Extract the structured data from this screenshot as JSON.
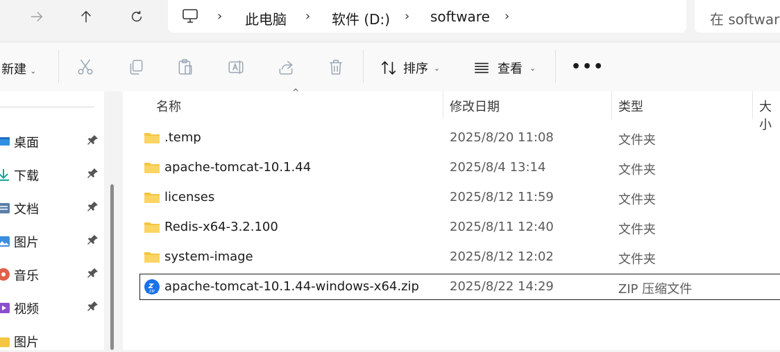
{
  "nav": {
    "forward_icon": "arrow-right-icon",
    "up_icon": "arrow-up-icon",
    "refresh_icon": "refresh-icon"
  },
  "address": {
    "computer_icon": "computer-icon",
    "crumbs": [
      "此电脑",
      "软件 (D:)",
      "software"
    ]
  },
  "search": {
    "placeholder": "在 software"
  },
  "toolbar": {
    "new_label": "新建",
    "sort_label": "排序",
    "view_label": "查看",
    "more_icon": "more-icon"
  },
  "sidebar": {
    "items": [
      {
        "label": "桌面",
        "icon": "desktop-icon",
        "pinned": true
      },
      {
        "label": "下载",
        "icon": "download-icon",
        "pinned": true
      },
      {
        "label": "文档",
        "icon": "documents-icon",
        "pinned": true
      },
      {
        "label": "图片",
        "icon": "pictures-icon",
        "pinned": true
      },
      {
        "label": "音乐",
        "icon": "music-icon",
        "pinned": true
      },
      {
        "label": "视频",
        "icon": "videos-icon",
        "pinned": true
      },
      {
        "label": "图片",
        "icon": "pictures-icon",
        "pinned": false
      }
    ]
  },
  "columns": {
    "name": "名称",
    "modified": "修改日期",
    "type": "类型",
    "size": "大小"
  },
  "files": [
    {
      "name": ".temp",
      "modified": "2025/8/20 11:08",
      "type": "文件夹",
      "icon": "folder-icon"
    },
    {
      "name": "apache-tomcat-10.1.44",
      "modified": "2025/8/4 13:14",
      "type": "文件夹",
      "icon": "folder-icon"
    },
    {
      "name": "licenses",
      "modified": "2025/8/12 11:59",
      "type": "文件夹",
      "icon": "folder-icon"
    },
    {
      "name": "Redis-x64-3.2.100",
      "modified": "2025/8/11 12:40",
      "type": "文件夹",
      "icon": "folder-icon"
    },
    {
      "name": "system-image",
      "modified": "2025/8/12 12:02",
      "type": "文件夹",
      "icon": "folder-icon"
    },
    {
      "name": "apache-tomcat-10.1.44-windows-x64.zip",
      "modified": "2025/8/22 14:29",
      "type": "ZIP 压缩文件",
      "icon": "zip-file-icon",
      "selected": true
    }
  ],
  "colors": {
    "folder": "#f4c542",
    "accent": "#1a73e8"
  }
}
